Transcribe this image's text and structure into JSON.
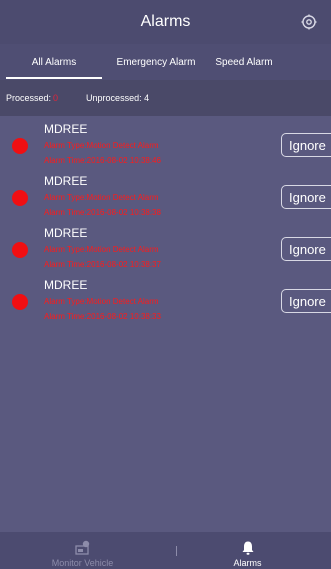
{
  "header": {
    "title": "Alarms",
    "settings_icon": "gear-icon"
  },
  "tabs": [
    {
      "label": "All Alarms",
      "active": true
    },
    {
      "label": "Emergency Alarm",
      "active": false
    },
    {
      "label": "Speed Alarm",
      "active": false
    }
  ],
  "status": {
    "processed_label": "Processed:",
    "processed_count": "0",
    "unprocessed_label": "Unprocessed: 4"
  },
  "alarms": [
    {
      "vehicle": "MDREE",
      "type": "Alarm Type:Motion Detect Alarm",
      "time": "Alarm Time:2016-08-02 10:38:46",
      "ignore_label": "Ignore"
    },
    {
      "vehicle": "MDREE",
      "type": "Alarm Type:Motion Detect Alarm",
      "time": "Alarm Time:2016-08-02 10:38:38",
      "ignore_label": "Ignore"
    },
    {
      "vehicle": "MDREE",
      "type": "Alarm Type:Motion Detect Alarm",
      "time": "Alarm Time:2016-08-02 10:38:37",
      "ignore_label": "Ignore"
    },
    {
      "vehicle": "MDREE",
      "type": "Alarm Type:Motion Detect Alarm",
      "time": "Alarm Time:2016-08-02 10:38:33",
      "ignore_label": "Ignore"
    }
  ],
  "bottom_nav": [
    {
      "label": "Monitor Vehicle",
      "icon": "monitor-vehicle-icon",
      "active": false
    },
    {
      "label": "Alarms",
      "icon": "bell-icon",
      "active": true
    }
  ],
  "colors": {
    "accent_red": "#f00f12",
    "background": "#5a597f",
    "header": "#4c4b6f"
  }
}
